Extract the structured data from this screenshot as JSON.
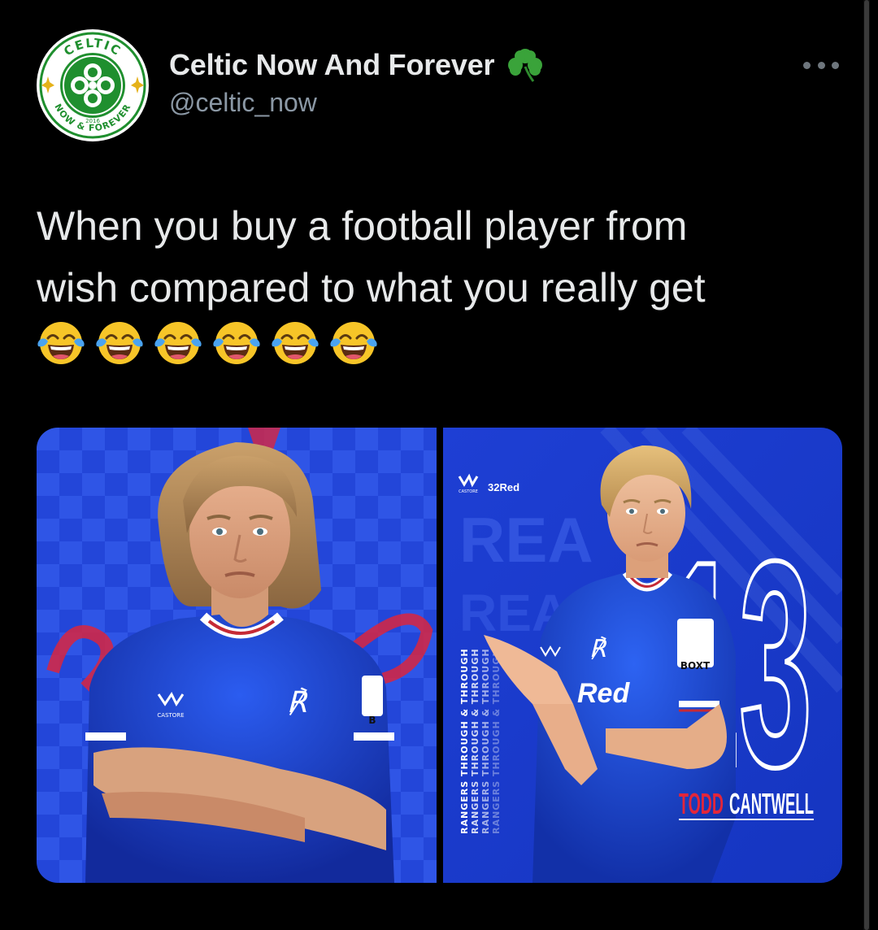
{
  "tweet": {
    "author": {
      "display_name": "Celtic Now And Forever",
      "handle": "@celtic_now",
      "badge_icon": "shamrock-icon",
      "avatar_logo": {
        "top_text": "CELTIC",
        "bottom_text": "NOW & FOREVER",
        "year": "2016",
        "colors": {
          "green": "#1f8f2e",
          "white": "#ffffff",
          "gold": "#e5b21a"
        }
      }
    },
    "text_lines": [
      "When you buy a football player from",
      "wish compared to what you really get"
    ],
    "emoji": {
      "name": "face-with-tears-of-joy-emoji",
      "count": 6
    },
    "more_menu_icon": "more-options-icon",
    "media": {
      "left_photo": {
        "kit_brand": "CASTORE",
        "sleeve_text": "B"
      },
      "right_photo": {
        "kit_brand": "CASTORE",
        "sponsor": "32Red",
        "shirt_sponsor": "Red",
        "sleeve_text": "BOXT",
        "background_word_1": "REA",
        "background_word_2": "READY",
        "side_text": "RANGERS THROUGH & THROUGH",
        "number": "13",
        "player_first_name": "TODD",
        "player_last_name": "CANTWELL"
      }
    },
    "colors": {
      "background": "#000000",
      "primary_text": "#e7e9ea",
      "secondary_text": "#8b98a5",
      "rangers_blue": "#1c3fd6",
      "rangers_red": "#d0213a"
    }
  }
}
